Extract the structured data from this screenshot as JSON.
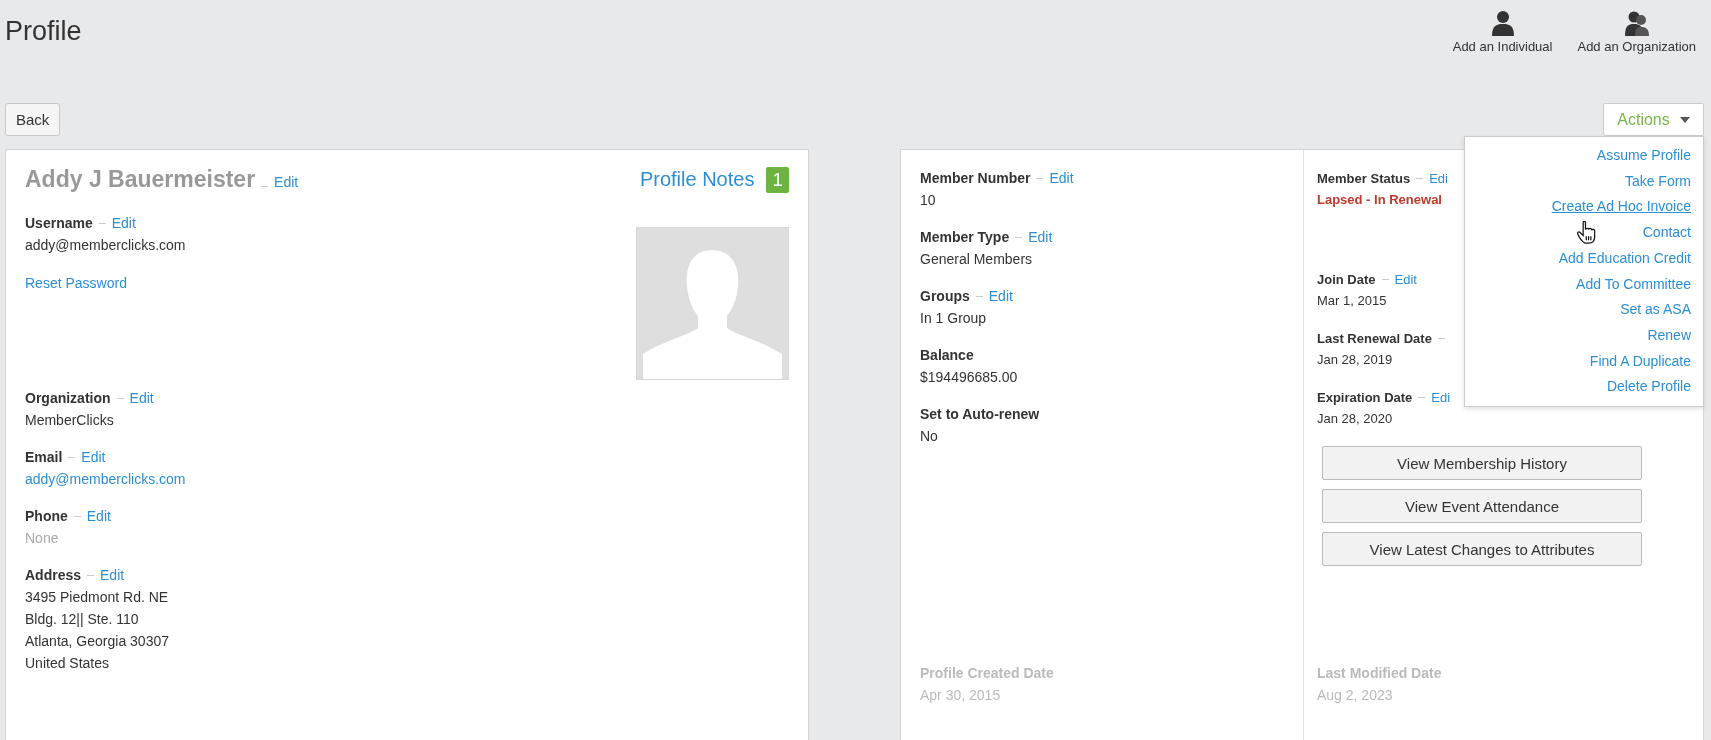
{
  "page_title": "Profile",
  "header_actions": [
    {
      "label": "Add an Individual",
      "kind": "individual"
    },
    {
      "label": "Add an Organization",
      "kind": "organization"
    }
  ],
  "back_button": "Back",
  "actions_menu": {
    "label": "Actions",
    "expanded": true,
    "items": [
      {
        "label": "Assume Profile",
        "hovered": false
      },
      {
        "label": "Take Form",
        "hovered": false
      },
      {
        "label": "Create Ad Hoc Invoice",
        "hovered": true
      },
      {
        "label": "Contact",
        "hovered": false
      },
      {
        "label": "Add Education Credit",
        "hovered": false
      },
      {
        "label": "Add To Committee",
        "hovered": false
      },
      {
        "label": "Set as ASA",
        "hovered": false
      },
      {
        "label": "Renew",
        "hovered": false
      },
      {
        "label": "Find A Duplicate",
        "hovered": false
      },
      {
        "label": "Delete Profile",
        "hovered": false
      }
    ]
  },
  "profile_card": {
    "name": "Addy J Bauermeister",
    "name_edit": "Edit",
    "notes_label": "Profile Notes",
    "notes_count": "1",
    "account_fields": [
      {
        "label": "Username",
        "editable": true,
        "edit": "Edit",
        "values": [
          {
            "text": "addy@memberclicks.com",
            "kind": "plain"
          }
        ]
      },
      {
        "values": [
          {
            "text": "Reset Password",
            "kind": "link"
          }
        ]
      }
    ],
    "contact_fields": [
      {
        "label": "Organization",
        "editable": true,
        "edit": "Edit",
        "values": [
          {
            "text": "MemberClicks",
            "kind": "plain"
          }
        ]
      },
      {
        "label": "Email",
        "editable": true,
        "edit": "Edit",
        "values": [
          {
            "text": "addy@memberclicks.com",
            "kind": "link"
          }
        ]
      },
      {
        "label": "Phone",
        "editable": true,
        "edit": "Edit",
        "values": [
          {
            "text": "None",
            "kind": "muted"
          }
        ]
      },
      {
        "label": "Address",
        "editable": true,
        "edit": "Edit",
        "values": [
          {
            "text": "3495 Piedmont Rd. NE",
            "kind": "plain"
          },
          {
            "text": "Bldg. 12|| Ste. 110",
            "kind": "plain"
          },
          {
            "text": "Atlanta, Georgia 30307",
            "kind": "plain"
          },
          {
            "text": "United States",
            "kind": "plain"
          }
        ]
      }
    ]
  },
  "membership_card": {
    "membership_fields": [
      {
        "label": "Member Number",
        "editable": true,
        "edit": "Edit",
        "values": [
          {
            "text": "10",
            "kind": "plain"
          }
        ]
      },
      {
        "label": "Member Type",
        "editable": true,
        "edit": "Edit",
        "values": [
          {
            "text": "General Members",
            "kind": "plain"
          }
        ]
      },
      {
        "label": "Groups",
        "editable": true,
        "edit": "Edit",
        "values": [
          {
            "text": "In 1 Group",
            "kind": "plain"
          }
        ]
      },
      {
        "label": "Balance",
        "editable": false,
        "values": [
          {
            "text": "$194496685.00",
            "kind": "plain"
          }
        ]
      },
      {
        "label": "Set to Auto-renew",
        "editable": false,
        "values": [
          {
            "text": "No",
            "kind": "plain"
          }
        ]
      }
    ],
    "status_fields": [
      {
        "label": "Member Status",
        "editable": true,
        "edit": "Edi",
        "values": [
          {
            "text": "Lapsed - In Renewal",
            "kind": "alert"
          }
        ]
      },
      {
        "label": "Join Date",
        "editable": true,
        "edit": "Edit",
        "values": [
          {
            "text": "Mar 1, 2015",
            "kind": "plain"
          }
        ]
      },
      {
        "label": "Last Renewal Date",
        "editable": true,
        "values": [
          {
            "text": "Jan 28, 2019",
            "kind": "plain"
          }
        ]
      },
      {
        "label": "Expiration Date",
        "editable": true,
        "edit": "Edi",
        "values": [
          {
            "text": "Jan 28, 2020",
            "kind": "plain"
          }
        ]
      }
    ],
    "history_buttons": [
      "View Membership History",
      "View Event Attendance",
      "View Latest Changes to Attributes"
    ],
    "created": {
      "label": "Profile Created Date",
      "value": "Apr 30, 2015"
    },
    "modified": {
      "label": "Last Modified Date",
      "value": "Aug 2, 2023"
    }
  }
}
